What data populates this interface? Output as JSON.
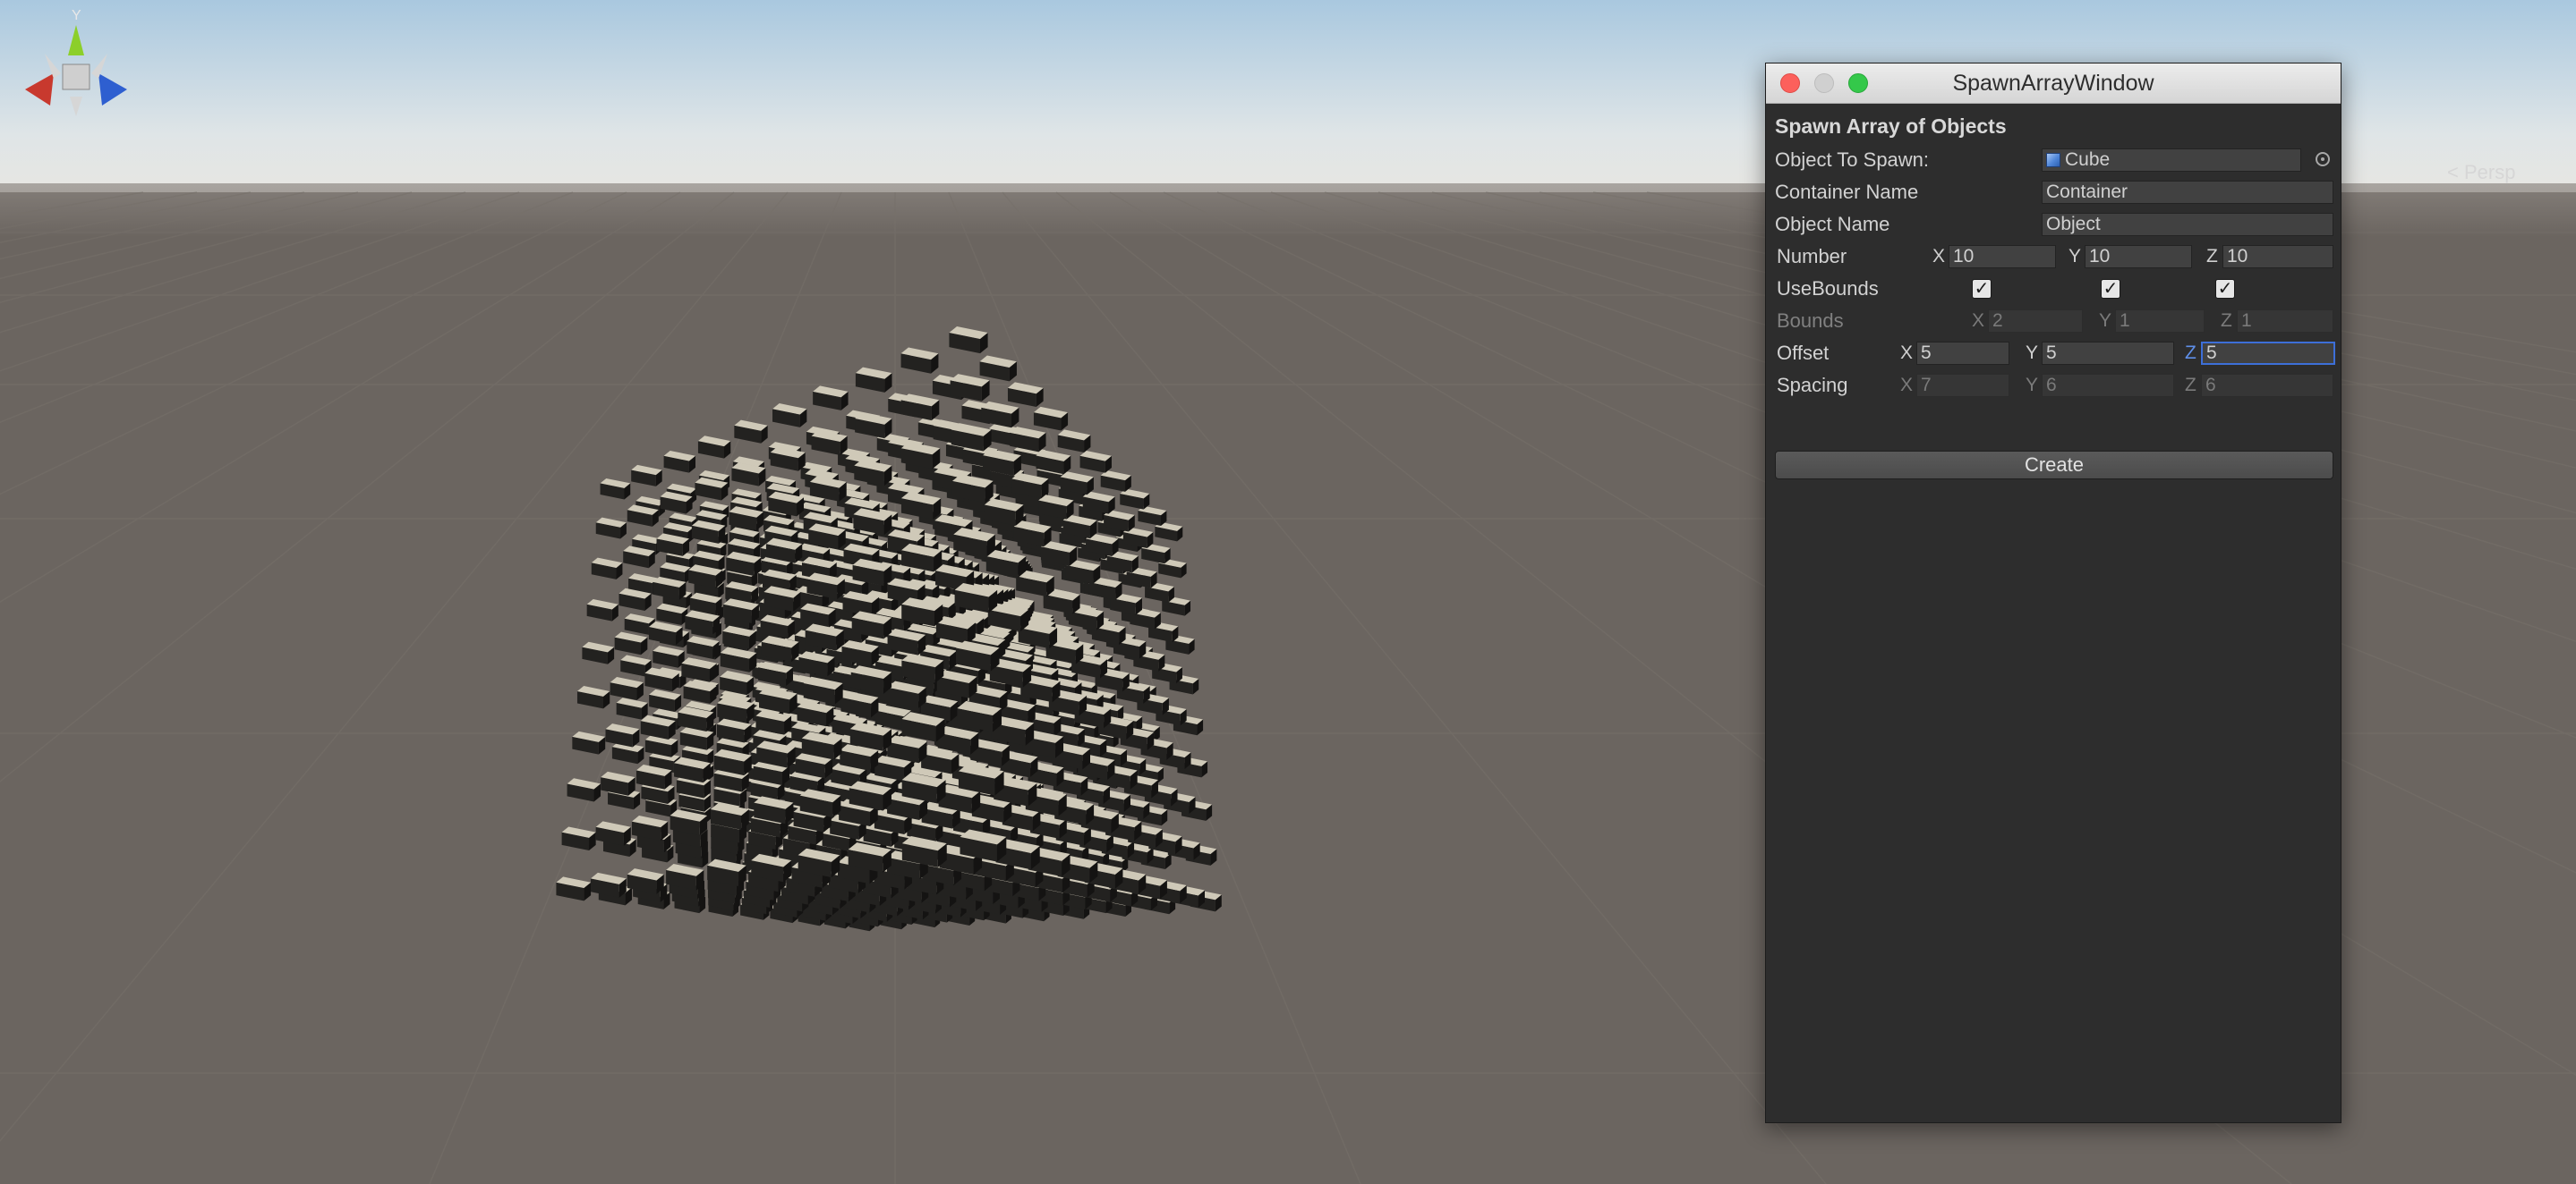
{
  "scene": {
    "projection_label": "Persp",
    "gizmo_axis_label": "Y",
    "colors": {
      "sky_top": "#a8c7de",
      "ground": "#6b6560",
      "cube_top": "#cfc9b8",
      "cube_side": "#232220"
    }
  },
  "window": {
    "title": "SpawnArrayWindow",
    "section_title": "Spawn Array of Objects",
    "object_to_spawn": {
      "label": "Object To Spawn:",
      "value": "Cube"
    },
    "container_name": {
      "label": "Container Name",
      "value": "Container"
    },
    "object_name": {
      "label": "Object Name",
      "value": "Object"
    },
    "number": {
      "label": "Number",
      "x": "10",
      "y": "10",
      "z": "10"
    },
    "use_bounds": {
      "label": "UseBounds",
      "x": true,
      "y": true,
      "z": true
    },
    "bounds": {
      "label": "Bounds",
      "x": "2",
      "y": "1",
      "z": "1"
    },
    "offset": {
      "label": "Offset",
      "x": "5",
      "y": "5",
      "z": "5"
    },
    "spacing": {
      "label": "Spacing",
      "x": "7",
      "y": "6",
      "z": "6"
    },
    "axis_labels": {
      "x": "X",
      "y": "Y",
      "z": "Z"
    },
    "create_label": "Create"
  }
}
